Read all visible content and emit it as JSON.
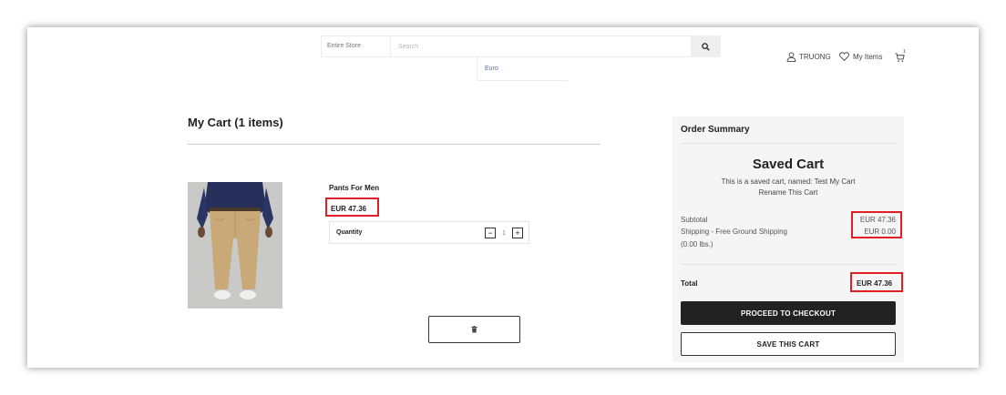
{
  "header": {
    "search_scope": "Entire Store",
    "search_placeholder": "Search",
    "currency": "Euro",
    "user_name": "TRUONG",
    "wishlist_label": "My Items",
    "cart_count": "1"
  },
  "cart": {
    "title": "My Cart (1 items)",
    "item": {
      "name": "Pants For Men",
      "price": "EUR 47.36",
      "quantity_label": "Quantity",
      "quantity_value": "1",
      "minus_label": "−",
      "plus_label": "+"
    }
  },
  "summary": {
    "title": "Order Summary",
    "saved_title": "Saved Cart",
    "saved_description": "This is a saved cart, named: Test My Cart",
    "rename_label": "Rename This Cart",
    "subtotal_label": "Subtotal",
    "subtotal_value": "EUR 47.36",
    "shipping_label": "Shipping - Free Ground Shipping",
    "shipping_value": "EUR 0.00",
    "weight_label": "(0.00 lbs.)",
    "total_label": "Total",
    "total_value": "EUR 47.36",
    "checkout_label": "PROCEED TO CHECKOUT",
    "save_label": "SAVE THIS CART"
  },
  "colors": {
    "highlight": "#e01e26",
    "primary_button": "#222222",
    "currency_link": "#4a6cb3"
  },
  "icons": [
    "search-icon",
    "user-icon",
    "heart-icon",
    "cart-icon",
    "trash-icon"
  ]
}
